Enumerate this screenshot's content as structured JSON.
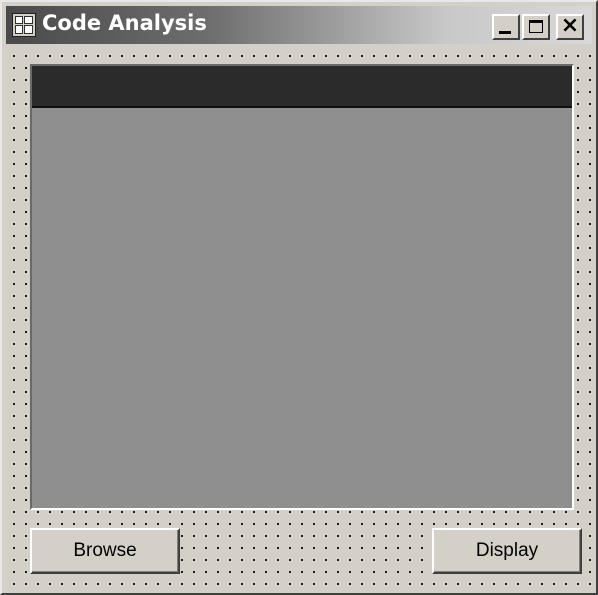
{
  "window": {
    "title": "Code Analysis",
    "icon": "form-designer-icon",
    "controls": {
      "minimize_icon": "minimize-icon",
      "maximize_icon": "maximize-icon",
      "close_label": "×"
    }
  },
  "main": {
    "grid_view": {
      "header_color": "#2b2b2b",
      "body_color": "#8f8f8f"
    },
    "buttons": {
      "browse_label": "Browse",
      "display_label": "Display"
    }
  },
  "colors": {
    "form_background": "#d4d0c8",
    "title_gradient_start": "#4a4a4a",
    "title_gradient_end": "#d8d8d8"
  }
}
